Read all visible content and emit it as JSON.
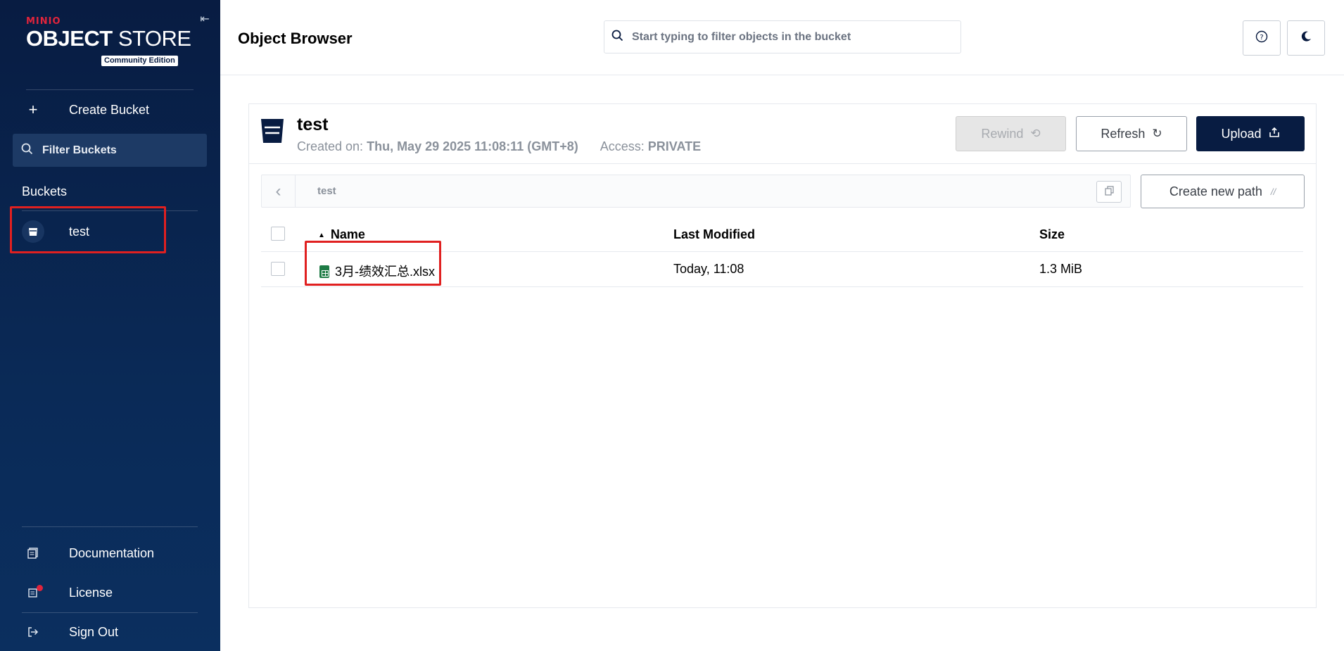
{
  "brand": {
    "minio": "MINIO",
    "title_bold": "OBJECT",
    "title_light": " STORE",
    "edition": "Community Edition"
  },
  "sidebar": {
    "collapse_icon": "collapse-left-icon",
    "create_bucket": "Create Bucket",
    "filter_placeholder": "Filter Buckets",
    "buckets_heading": "Buckets",
    "buckets": [
      {
        "name": "test",
        "icon": "bucket-icon"
      }
    ],
    "documentation": "Documentation",
    "license": "License",
    "sign_out": "Sign Out"
  },
  "header": {
    "title": "Object Browser",
    "search_placeholder": "Start typing to filter objects in the bucket",
    "help_icon": "help-circle-icon",
    "theme_icon": "moon-icon"
  },
  "bucket": {
    "name": "test",
    "created_label": "Created on:",
    "created_value": "Thu, May 29 2025 11:08:11 (GMT+8)",
    "access_label": "Access:",
    "access_value": "PRIVATE"
  },
  "actions": {
    "rewind": "Rewind",
    "refresh": "Refresh",
    "upload": "Upload",
    "create_path": "Create new path"
  },
  "path": {
    "current": "test"
  },
  "table": {
    "columns": {
      "name": "Name",
      "modified": "Last Modified",
      "size": "Size"
    },
    "rows": [
      {
        "name": "3月-绩效汇总.xlsx",
        "modified": "Today, 11:08",
        "size": "1.3 MiB"
      }
    ]
  },
  "colors": {
    "sidebar_bg": "#081c42",
    "accent_red": "#e1243c",
    "upload_bg": "#081c42",
    "highlight_box": "#e02020"
  }
}
